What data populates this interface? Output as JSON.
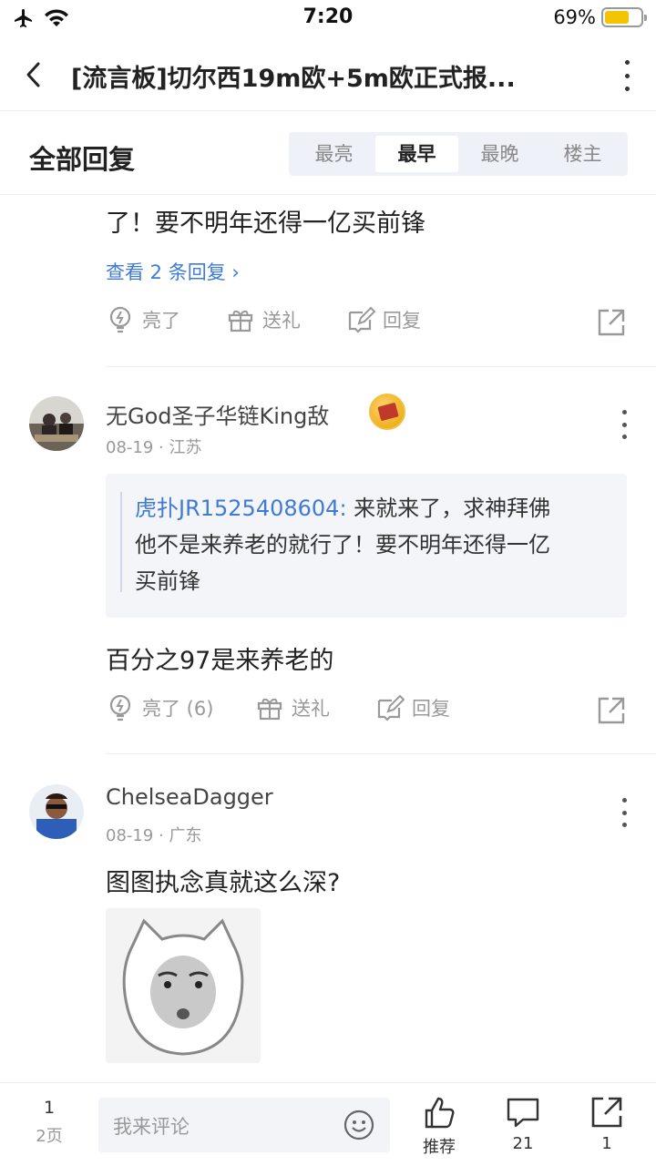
{
  "status": {
    "time": "7:20",
    "battery": "69%",
    "battery_level": 0.69
  },
  "nav": {
    "title": "[流言板]切尔西19m欧+5m欧正式报..."
  },
  "reply_header": {
    "label": "全部回复",
    "tabs": [
      "最亮",
      "最早",
      "最晚",
      "楼主"
    ],
    "active_tab": "最早"
  },
  "post0": {
    "text_tail": "了！要不明年还得一亿买前锋",
    "view_replies": "查看 2 条回复",
    "actions": {
      "like": "亮了",
      "gift": "送礼",
      "reply": "回复"
    }
  },
  "post1": {
    "username": "无God圣子华链King敌",
    "date": "08-19",
    "location": "江苏",
    "quote_name": "虎扑JR1525408604:",
    "quote_line1": " 来就来了，求神拜佛",
    "quote_line2": "他不是来养老的就行了！要不明年还得一亿",
    "quote_line3": "买前锋",
    "text": "百分之97是来养老的",
    "actions": {
      "like": "亮了 (6)",
      "gift": "送礼",
      "reply": "回复"
    }
  },
  "post2": {
    "username": "ChelseaDagger",
    "date": "08-19",
    "location": "广东",
    "text": "图图执念真就这么深?"
  },
  "bottom": {
    "page_current": "1",
    "page_total": "2页",
    "comment_placeholder": "我来评论",
    "recommend": "推荐",
    "comments": "21",
    "shares": "1"
  },
  "colors": {
    "link": "#3f7bd6",
    "battery": "#f5c400"
  }
}
